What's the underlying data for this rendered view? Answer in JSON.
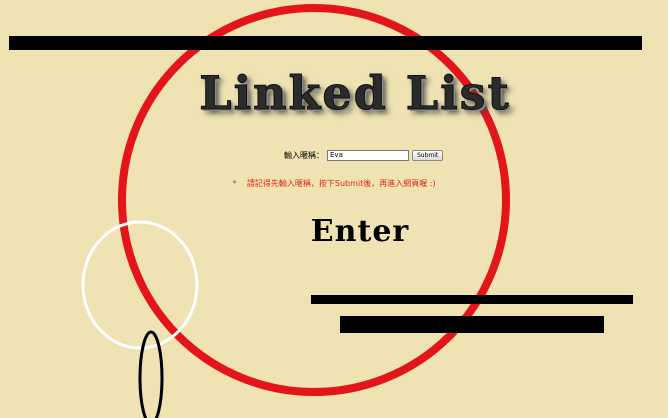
{
  "title": "Linked List",
  "form": {
    "label": "輸入暱稱：",
    "input_value": "Eva",
    "submit_label": "Submit"
  },
  "notice": {
    "marker": "*",
    "text": "請記得先輸入暱稱，按下Submit後，再進入網頁喔 :)"
  },
  "enter_label": "Enter",
  "colors": {
    "background": "#efe3b3",
    "circle": "#e3141a",
    "notice": "#e0281f"
  }
}
